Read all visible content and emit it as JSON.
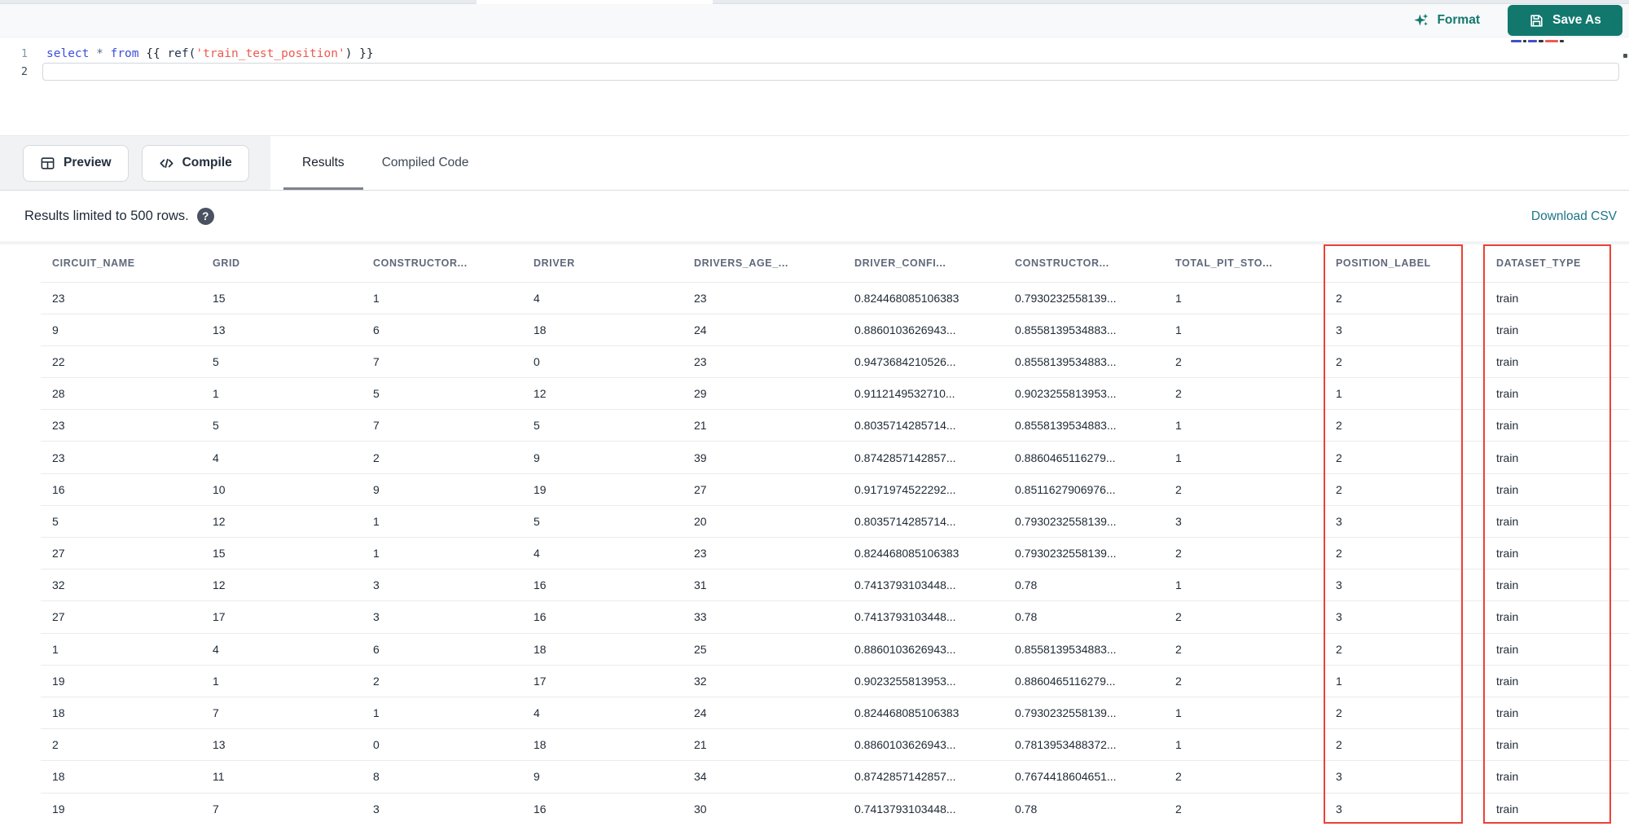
{
  "editor_header": {
    "format_label": "Format",
    "save_as_label": "Save As"
  },
  "editor": {
    "text": "select * from {{ ref('train_test_position') }}",
    "lines": [
      {
        "number": "1"
      },
      {
        "number": "2"
      }
    ],
    "code_tokens": [
      {
        "text": "select",
        "type": "keyword"
      },
      {
        "text": " * ",
        "type": "operator"
      },
      {
        "text": "from",
        "type": "keyword"
      },
      {
        "text": " {{ ",
        "type": "punctuation"
      },
      {
        "text": "ref(",
        "type": "function"
      },
      {
        "text": "'train_test_position'",
        "type": "string"
      },
      {
        "text": ") }}",
        "type": "punctuation"
      }
    ]
  },
  "toolbar": {
    "preview_label": "Preview",
    "compile_label": "Compile",
    "tabs": [
      {
        "label": "Results",
        "active": true
      },
      {
        "label": "Compiled Code",
        "active": false
      }
    ]
  },
  "results_bar": {
    "limit_text": "Results limited to 500 rows.",
    "help_glyph": "?",
    "download_label": "Download CSV"
  },
  "table": {
    "columns": [
      "CIRCUIT_NAME",
      "GRID",
      "CONSTRUCTOR...",
      "DRIVER",
      "DRIVERS_AGE_...",
      "DRIVER_CONFI...",
      "CONSTRUCTOR...",
      "TOTAL_PIT_STO...",
      "POSITION_LABEL",
      "DATASET_TYPE"
    ],
    "highlighted_columns": [
      "POSITION_LABEL",
      "DATASET_TYPE"
    ],
    "highlight_color": "#ee4037",
    "rows": [
      [
        "23",
        "15",
        "1",
        "4",
        "23",
        "0.824468085106383",
        "0.7930232558139...",
        "1",
        "2",
        "train"
      ],
      [
        "9",
        "13",
        "6",
        "18",
        "24",
        "0.8860103626943...",
        "0.8558139534883...",
        "1",
        "3",
        "train"
      ],
      [
        "22",
        "5",
        "7",
        "0",
        "23",
        "0.9473684210526...",
        "0.8558139534883...",
        "2",
        "2",
        "train"
      ],
      [
        "28",
        "1",
        "5",
        "12",
        "29",
        "0.9112149532710...",
        "0.9023255813953...",
        "2",
        "1",
        "train"
      ],
      [
        "23",
        "5",
        "7",
        "5",
        "21",
        "0.8035714285714...",
        "0.8558139534883...",
        "1",
        "2",
        "train"
      ],
      [
        "23",
        "4",
        "2",
        "9",
        "39",
        "0.8742857142857...",
        "0.8860465116279...",
        "1",
        "2",
        "train"
      ],
      [
        "16",
        "10",
        "9",
        "19",
        "27",
        "0.9171974522292...",
        "0.8511627906976...",
        "2",
        "2",
        "train"
      ],
      [
        "5",
        "12",
        "1",
        "5",
        "20",
        "0.8035714285714...",
        "0.7930232558139...",
        "3",
        "3",
        "train"
      ],
      [
        "27",
        "15",
        "1",
        "4",
        "23",
        "0.824468085106383",
        "0.7930232558139...",
        "2",
        "2",
        "train"
      ],
      [
        "32",
        "12",
        "3",
        "16",
        "31",
        "0.7413793103448...",
        "0.78",
        "1",
        "3",
        "train"
      ],
      [
        "27",
        "17",
        "3",
        "16",
        "33",
        "0.7413793103448...",
        "0.78",
        "2",
        "3",
        "train"
      ],
      [
        "1",
        "4",
        "6",
        "18",
        "25",
        "0.8860103626943...",
        "0.8558139534883...",
        "2",
        "2",
        "train"
      ],
      [
        "19",
        "1",
        "2",
        "17",
        "32",
        "0.9023255813953...",
        "0.8860465116279...",
        "2",
        "1",
        "train"
      ],
      [
        "18",
        "7",
        "1",
        "4",
        "24",
        "0.824468085106383",
        "0.7930232558139...",
        "1",
        "2",
        "train"
      ],
      [
        "2",
        "13",
        "0",
        "18",
        "21",
        "0.8860103626943...",
        "0.7813953488372...",
        "1",
        "2",
        "train"
      ],
      [
        "18",
        "11",
        "8",
        "9",
        "34",
        "0.8742857142857...",
        "0.7674418604651...",
        "2",
        "3",
        "train"
      ],
      [
        "19",
        "7",
        "3",
        "16",
        "30",
        "0.7413793103448...",
        "0.78",
        "2",
        "3",
        "train"
      ]
    ]
  },
  "colors": {
    "accent_teal": "#12786e",
    "link_teal": "#1b7487",
    "highlight_red": "#ee4037",
    "keyword_blue": "#3d4fd9",
    "string_red": "#ee5a50"
  }
}
